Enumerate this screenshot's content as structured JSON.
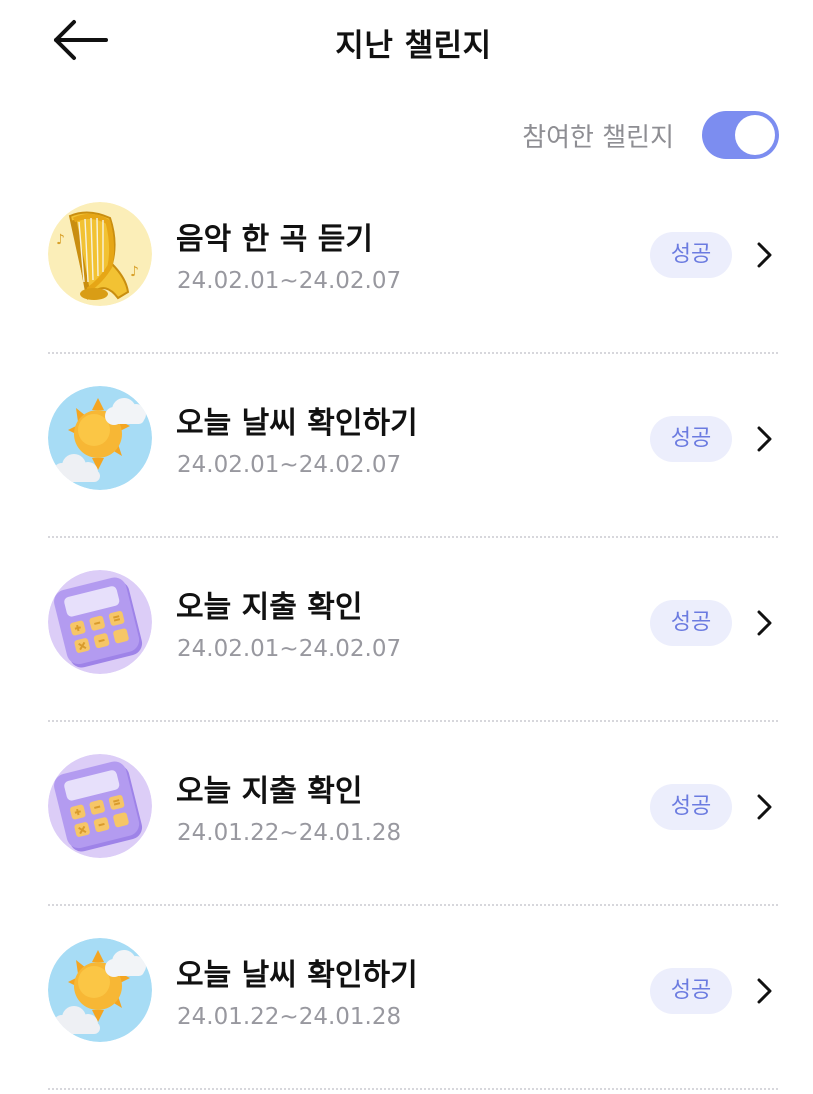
{
  "header": {
    "title": "지난 챌린지",
    "back_icon": "arrow-left-icon"
  },
  "filter": {
    "label": "참여한 챌린지",
    "toggle_on": true,
    "accent_color": "#7c8df0"
  },
  "items": [
    {
      "title": "음악 한 곡 듣기",
      "date": "24.02.01~24.02.07",
      "status": "성공",
      "icon": "harp-icon"
    },
    {
      "title": "오늘 날씨 확인하기",
      "date": "24.02.01~24.02.07",
      "status": "성공",
      "icon": "sun-cloud-icon"
    },
    {
      "title": "오늘 지출 확인",
      "date": "24.02.01~24.02.07",
      "status": "성공",
      "icon": "calculator-icon"
    },
    {
      "title": "오늘 지출 확인",
      "date": "24.01.22~24.01.28",
      "status": "성공",
      "icon": "calculator-icon"
    },
    {
      "title": "오늘 날씨 확인하기",
      "date": "24.01.22~24.01.28",
      "status": "성공",
      "icon": "sun-cloud-icon"
    }
  ]
}
